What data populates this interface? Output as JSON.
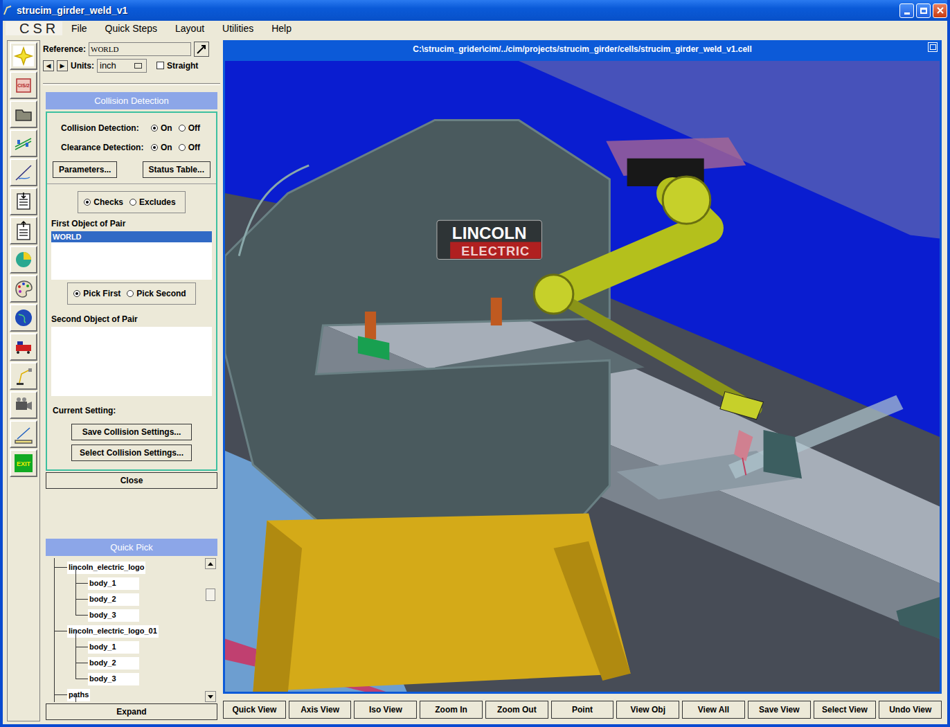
{
  "window": {
    "title": "strucim_girder_weld_v1"
  },
  "logo": "CSR",
  "menu": [
    "File",
    "Quick Steps",
    "Layout",
    "Utilities",
    "Help"
  ],
  "toolbar": [
    {
      "kind": "star"
    },
    {
      "kind": "cis",
      "label": "CIS/2"
    },
    {
      "kind": "folder"
    },
    {
      "kind": "conveyor"
    },
    {
      "kind": "path"
    },
    {
      "kind": "import"
    },
    {
      "kind": "export"
    },
    {
      "kind": "pie"
    },
    {
      "kind": "palette"
    },
    {
      "kind": "globe"
    },
    {
      "kind": "train"
    },
    {
      "kind": "robot"
    },
    {
      "kind": "camera"
    },
    {
      "kind": "measure"
    },
    {
      "kind": "exit",
      "label": "EXIT"
    }
  ],
  "reference": {
    "label": "Reference:",
    "value": "WORLD"
  },
  "units": {
    "prev": "◀",
    "next": "▶",
    "label": "Units:",
    "value": "inch",
    "straight_label": "Straight",
    "straight_checked": false
  },
  "collision": {
    "title": "Collision Detection",
    "options": [
      {
        "label": "Collision Detection:",
        "choices": [
          {
            "label": "On",
            "selected": true
          },
          {
            "label": "Off",
            "selected": false
          }
        ]
      },
      {
        "label": "Clearance Detection:",
        "choices": [
          {
            "label": "On",
            "selected": true
          },
          {
            "label": "Off",
            "selected": false
          }
        ]
      }
    ],
    "buttons": [
      "Parameters...",
      "Status Table..."
    ],
    "mode": [
      {
        "label": "Checks",
        "selected": true
      },
      {
        "label": "Excludes",
        "selected": false
      }
    ],
    "first_label": "First Object of Pair",
    "first_items": [
      {
        "label": "WORLD",
        "selected": true
      }
    ],
    "pick": [
      {
        "label": "Pick First",
        "selected": true
      },
      {
        "label": "Pick Second",
        "selected": false
      }
    ],
    "second_label": "Second Object of Pair",
    "second_items": [],
    "current_label": "Current Setting:",
    "setting_buttons": [
      "Save Collision Settings...",
      "Select Collision Settings..."
    ],
    "close": "Close"
  },
  "quick_pick": {
    "title": "Quick Pick",
    "tree": [
      {
        "label": "lincoln_electric_logo",
        "level": 1,
        "color": "#ffffff"
      },
      {
        "label": "body_1",
        "level": 2,
        "color": "#ffffff"
      },
      {
        "label": "body_2",
        "level": 2,
        "color": "#ffffff"
      },
      {
        "label": "body_3",
        "level": 2,
        "color": "#ffffff"
      },
      {
        "label": "lincoln_electric_logo_01",
        "level": 1,
        "color": "#ffffff"
      },
      {
        "label": "body_1",
        "level": 2,
        "color": "#ffffff"
      },
      {
        "label": "body_2",
        "level": 2,
        "color": "#ffffff"
      },
      {
        "label": "body_3",
        "level": 2,
        "color": "#ffffff"
      },
      {
        "label": "paths",
        "level": 1,
        "color": "#ffffff"
      },
      {
        "label": "",
        "level": 2,
        "color": "#e00000"
      }
    ],
    "expand": "Expand"
  },
  "viewport": {
    "path": "C:\\strucim_grider\\cim/../cim/projects/strucim_girder/cells/strucim_girder_weld_v1.cell",
    "logo_top": "LINCOLN",
    "logo_bottom": "ELECTRIC"
  },
  "view_buttons": [
    "Quick View",
    "Axis View",
    "Iso View",
    "Zoom In",
    "Zoom Out",
    "Point",
    "View Obj",
    "View All",
    "Save View",
    "Select View",
    "Undo View"
  ]
}
